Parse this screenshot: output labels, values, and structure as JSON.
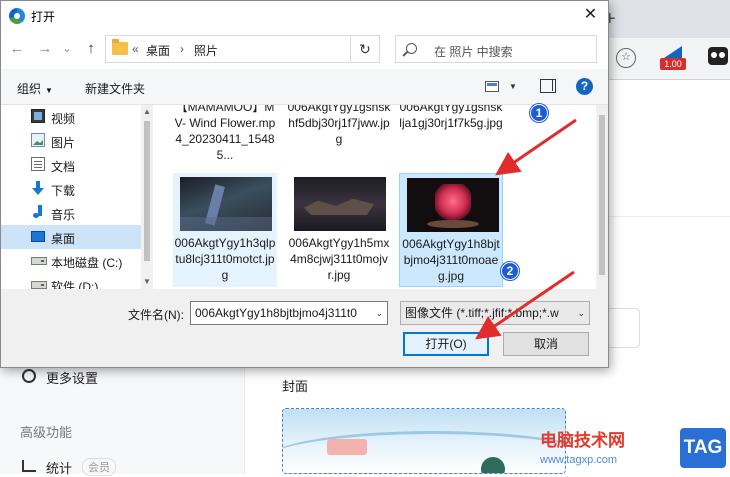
{
  "dialog": {
    "title": "打开",
    "close_glyph": "✕",
    "nav": {
      "back": "←",
      "forward": "→",
      "recent": "⌄",
      "up": "↑",
      "refresh": "↻"
    },
    "breadcrumb": {
      "overflow": "«",
      "items": [
        "桌面",
        "照片"
      ],
      "sep": "›",
      "dropdown": "⌄"
    },
    "search_placeholder": "在 照片 中搜索",
    "toolbar": {
      "organize": "组织",
      "new_folder": "新建文件夹",
      "help": "?"
    },
    "sidebar": [
      {
        "label": "视频",
        "icon": "video-icon"
      },
      {
        "label": "图片",
        "icon": "picture-icon"
      },
      {
        "label": "文档",
        "icon": "document-icon"
      },
      {
        "label": "下载",
        "icon": "download-icon"
      },
      {
        "label": "音乐",
        "icon": "music-icon"
      },
      {
        "label": "桌面",
        "icon": "desktop-icon",
        "selected": true
      },
      {
        "label": "本地磁盘 (C:)",
        "icon": "drive-icon"
      },
      {
        "label": "软件 (D:)",
        "icon": "drive-icon"
      }
    ],
    "files_row1": [
      {
        "name": "【MAMAMOO】MV- Wind Flower.mp4_20230411_15485..."
      },
      {
        "name": "006AkgtYgy1gsnskhf5dbj30rj1f7jww.jpg"
      },
      {
        "name": "006AkgtYgy1gsnsklja1gj30rj1f7k5g.jpg"
      }
    ],
    "files_row2": [
      {
        "name": "006AkgtYgy1h3qlptu8lcj311t0motct.jpg"
      },
      {
        "name": "006AkgtYgy1h5mx4m8cjwj311t0mojvr.jpg"
      },
      {
        "name": "006AkgtYgy1h8bjtbjmo4j311t0moaeg.jpg",
        "selected": true
      }
    ],
    "filename_label": "文件名(N):",
    "filename_value": "006AkgtYgy1h8bjtbjmo4j311t0",
    "filetype_value": "图像文件 (*.tiff;*.jfif;*.bmp;*.w",
    "open_button": "打开(O)",
    "cancel_button": "取消",
    "annotations": [
      "1",
      "2"
    ]
  },
  "background": {
    "plus": "+",
    "ext_badge": "1.00",
    "more_settings": "更多设置",
    "advanced": "高级功能",
    "stats": "统计",
    "vip": "会员",
    "cover_label": "封面",
    "watermark": {
      "text": "电脑技术网",
      "url": "www.tagxp.com",
      "tag": "TAG"
    }
  },
  "colors": {
    "accent": "#0078d7",
    "selection": "#cce8ff",
    "arrow": "#e22b2b",
    "badge": "#1d5bd8"
  }
}
